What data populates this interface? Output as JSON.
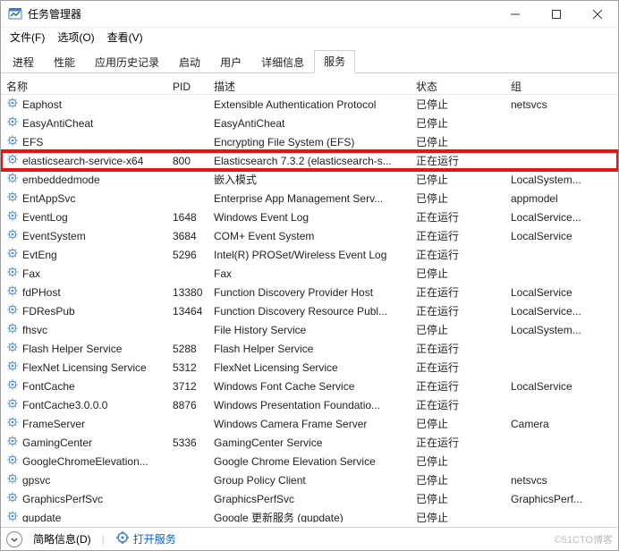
{
  "window": {
    "title": "任务管理器"
  },
  "menu": {
    "file": "文件(F)",
    "options": "选项(O)",
    "view": "查看(V)"
  },
  "tabs": {
    "processes": "进程",
    "performance": "性能",
    "apphistory": "应用历史记录",
    "startup": "启动",
    "users": "用户",
    "details": "详细信息",
    "services": "服务",
    "active": "services"
  },
  "columns": {
    "name": "名称",
    "pid": "PID",
    "desc": "描述",
    "status": "状态",
    "group": "组"
  },
  "statusbar": {
    "fewer_details": "简略信息(D)",
    "open_services": "打开服务"
  },
  "attribution": "©51CTO博客",
  "services": [
    {
      "name": "Eaphost",
      "pid": "",
      "desc": "Extensible Authentication Protocol",
      "status": "已停止",
      "group": "netsvcs",
      "hl": false
    },
    {
      "name": "EasyAntiCheat",
      "pid": "",
      "desc": "EasyAntiCheat",
      "status": "已停止",
      "group": "",
      "hl": false
    },
    {
      "name": "EFS",
      "pid": "",
      "desc": "Encrypting File System (EFS)",
      "status": "已停止",
      "group": "",
      "hl": false
    },
    {
      "name": "elasticsearch-service-x64",
      "pid": "800",
      "desc": "Elasticsearch 7.3.2 (elasticsearch-s...",
      "status": "正在运行",
      "group": "",
      "hl": true
    },
    {
      "name": "embeddedmode",
      "pid": "",
      "desc": "嵌入模式",
      "status": "已停止",
      "group": "LocalSystem...",
      "hl": false
    },
    {
      "name": "EntAppSvc",
      "pid": "",
      "desc": "Enterprise App Management Serv...",
      "status": "已停止",
      "group": "appmodel",
      "hl": false
    },
    {
      "name": "EventLog",
      "pid": "1648",
      "desc": "Windows Event Log",
      "status": "正在运行",
      "group": "LocalService...",
      "hl": false
    },
    {
      "name": "EventSystem",
      "pid": "3684",
      "desc": "COM+ Event System",
      "status": "正在运行",
      "group": "LocalService",
      "hl": false
    },
    {
      "name": "EvtEng",
      "pid": "5296",
      "desc": "Intel(R) PROSet/Wireless Event Log",
      "status": "正在运行",
      "group": "",
      "hl": false
    },
    {
      "name": "Fax",
      "pid": "",
      "desc": "Fax",
      "status": "已停止",
      "group": "",
      "hl": false
    },
    {
      "name": "fdPHost",
      "pid": "13380",
      "desc": "Function Discovery Provider Host",
      "status": "正在运行",
      "group": "LocalService",
      "hl": false
    },
    {
      "name": "FDResPub",
      "pid": "13464",
      "desc": "Function Discovery Resource Publ...",
      "status": "正在运行",
      "group": "LocalService...",
      "hl": false
    },
    {
      "name": "fhsvc",
      "pid": "",
      "desc": "File History Service",
      "status": "已停止",
      "group": "LocalSystem...",
      "hl": false
    },
    {
      "name": "Flash Helper Service",
      "pid": "5288",
      "desc": "Flash Helper Service",
      "status": "正在运行",
      "group": "",
      "hl": false
    },
    {
      "name": "FlexNet Licensing Service",
      "pid": "5312",
      "desc": "FlexNet Licensing Service",
      "status": "正在运行",
      "group": "",
      "hl": false
    },
    {
      "name": "FontCache",
      "pid": "3712",
      "desc": "Windows Font Cache Service",
      "status": "正在运行",
      "group": "LocalService",
      "hl": false
    },
    {
      "name": "FontCache3.0.0.0",
      "pid": "8876",
      "desc": "Windows Presentation Foundatio...",
      "status": "正在运行",
      "group": "",
      "hl": false
    },
    {
      "name": "FrameServer",
      "pid": "",
      "desc": "Windows Camera Frame Server",
      "status": "已停止",
      "group": "Camera",
      "hl": false
    },
    {
      "name": "GamingCenter",
      "pid": "5336",
      "desc": "GamingCenter Service",
      "status": "正在运行",
      "group": "",
      "hl": false
    },
    {
      "name": "GoogleChromeElevation...",
      "pid": "",
      "desc": "Google Chrome Elevation Service",
      "status": "已停止",
      "group": "",
      "hl": false
    },
    {
      "name": "gpsvc",
      "pid": "",
      "desc": "Group Policy Client",
      "status": "已停止",
      "group": "netsvcs",
      "hl": false
    },
    {
      "name": "GraphicsPerfSvc",
      "pid": "",
      "desc": "GraphicsPerfSvc",
      "status": "已停止",
      "group": "GraphicsPerf...",
      "hl": false
    },
    {
      "name": "gupdate",
      "pid": "",
      "desc": "Google 更新服务 (gupdate)",
      "status": "已停止",
      "group": "",
      "hl": false
    }
  ]
}
